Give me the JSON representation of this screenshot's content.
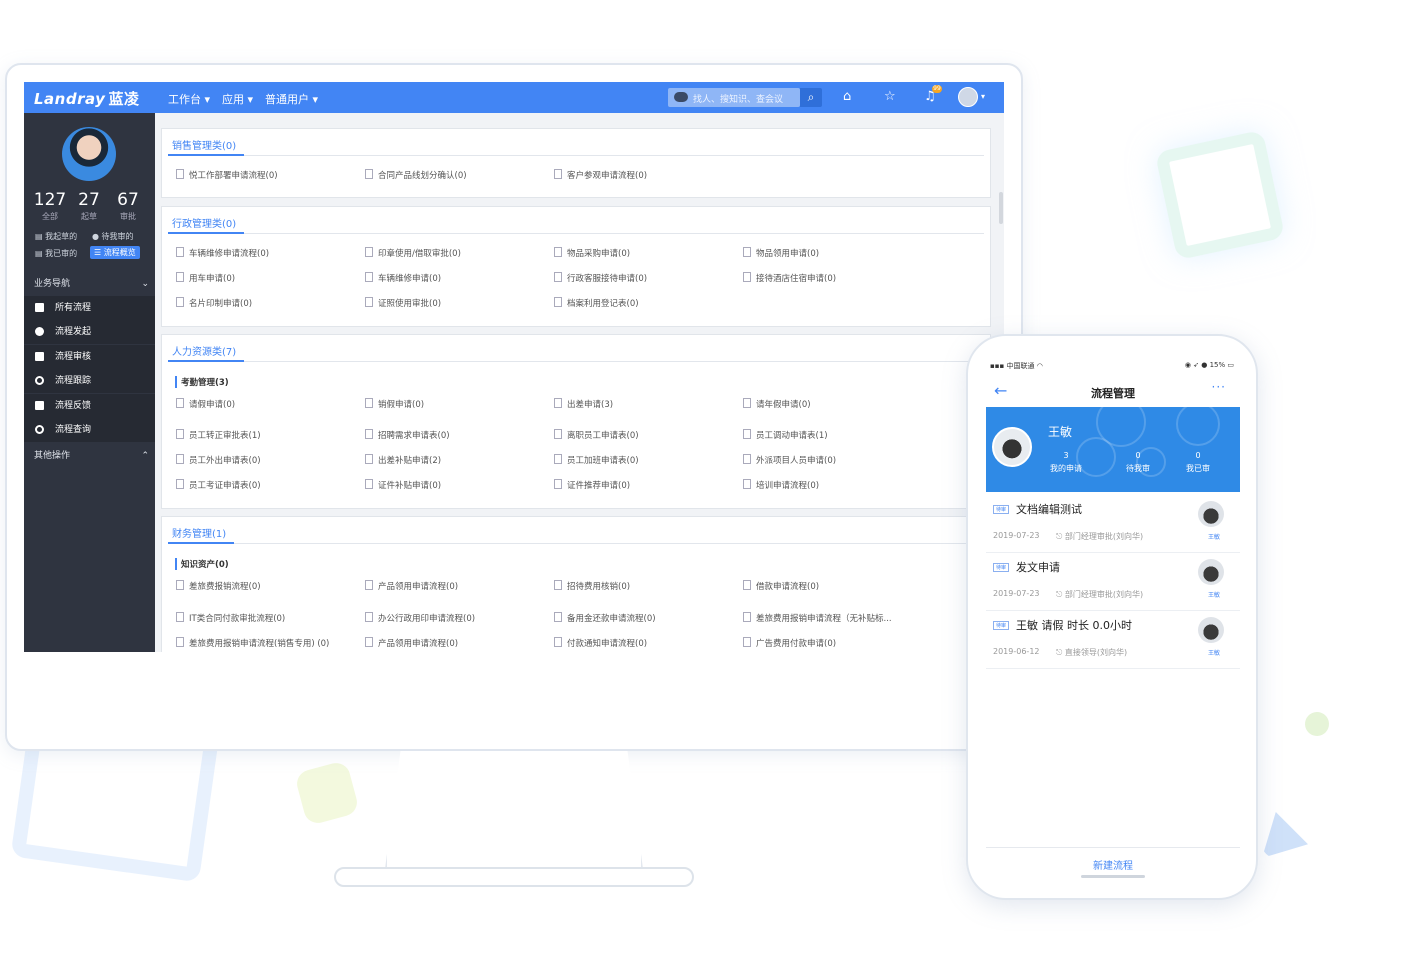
{
  "desktop": {
    "logo": "Landray",
    "logo_cn": "蓝凌",
    "menu": [
      "工作台 ▾",
      "应用 ▾",
      "普通用户 ▾"
    ],
    "search_placeholder": "找人、搜知识、查会议",
    "notif_count": "99",
    "sidebar": {
      "stats": [
        {
          "num": "127",
          "label": "全部"
        },
        {
          "num": "27",
          "label": "起草"
        },
        {
          "num": "67",
          "label": "审批"
        }
      ],
      "mini_links": [
        "我起草的",
        "待我审的",
        "我已审的",
        "流程概览"
      ],
      "nav_head": "业务导航",
      "nav_items": [
        "所有流程",
        "流程发起",
        "流程审核",
        "流程跟踪",
        "流程反馈",
        "流程查询"
      ],
      "other_head": "其他操作",
      "chevron_down": "⌄",
      "chevron_up": "⌃"
    },
    "panels": [
      {
        "title": "销售管理类(0)",
        "items": [
          "悦工作部署申请流程(0)",
          "合同产品线划分确认(0)",
          "客户参观申请流程(0)"
        ]
      },
      {
        "title": "行政管理类(0)",
        "items": [
          "车辆维修申请流程(0)",
          "印章使用/借取审批(0)",
          "物品采购申请(0)",
          "物品领用申请(0)",
          "用车申请(0)",
          "车辆维修申请(0)",
          "行政客服接待申请(0)",
          "接待酒店住宿申请(0)",
          "名片印制申请(0)",
          "证照使用审批(0)",
          "档案利用登记表(0)"
        ]
      },
      {
        "title": "人力资源类(7)",
        "sub": "考勤管理(3)",
        "items": [
          "请假申请(0)",
          "销假申请(0)",
          "出差申请(3)",
          "请年假申请(0)",
          "员工转正审批表(1)",
          "招聘需求申请表(0)",
          "离职员工申请表(0)",
          "员工调动申请表(1)",
          "员工外出申请表(0)",
          "出差补贴申请(2)",
          "员工加班申请表(0)",
          "外派项目人员申请(0)",
          "员工考证申请表(0)",
          "证件补贴申请(0)",
          "证件推荐申请(0)",
          "培训申请流程(0)"
        ]
      },
      {
        "title": "财务管理(1)",
        "sub": "知识资产(0)",
        "items": [
          "差旅费报销流程(0)",
          "产品领用申请流程(0)",
          "招待费用核销(0)",
          "借款申请流程(0)",
          "IT类合同付款审批流程(0)",
          "办公行政用印申请流程(0)",
          "备用金还款申请流程(0)",
          "差旅费用报销申请流程（无补贴标...",
          "差旅费用报销申请流程(销售专用) (0)",
          "产品领用申请流程(0)",
          "付款通知申请流程(0)",
          "广告费用付款申请(0)"
        ]
      }
    ]
  },
  "mobile": {
    "carrier": "中国联通",
    "battery": "15%",
    "title": "流程管理",
    "back": "←",
    "more": "···",
    "user_name": "王敏",
    "stats": [
      {
        "num": "3",
        "label": "我的申请"
      },
      {
        "num": "0",
        "label": "待我审"
      },
      {
        "num": "0",
        "label": "我已审"
      }
    ],
    "cards": [
      {
        "tag": "待审",
        "title": "文档编辑测试",
        "date": "2019-07-23",
        "node": "部门经理审批(刘向华)",
        "user": "王敏"
      },
      {
        "tag": "待审",
        "title": "发文申请",
        "date": "2019-07-23",
        "node": "部门经理审批(刘向华)",
        "user": "王敏"
      },
      {
        "tag": "待审",
        "title": "王敏 请假 时长 0.0小时",
        "date": "2019-06-12",
        "node": "直接领导(刘向华)",
        "user": "王敏"
      }
    ],
    "new_flow": "新建流程"
  },
  "colors": {
    "accent": "#4285f4",
    "sidebar": "#2f3440",
    "banner": "#2f8ae6"
  }
}
